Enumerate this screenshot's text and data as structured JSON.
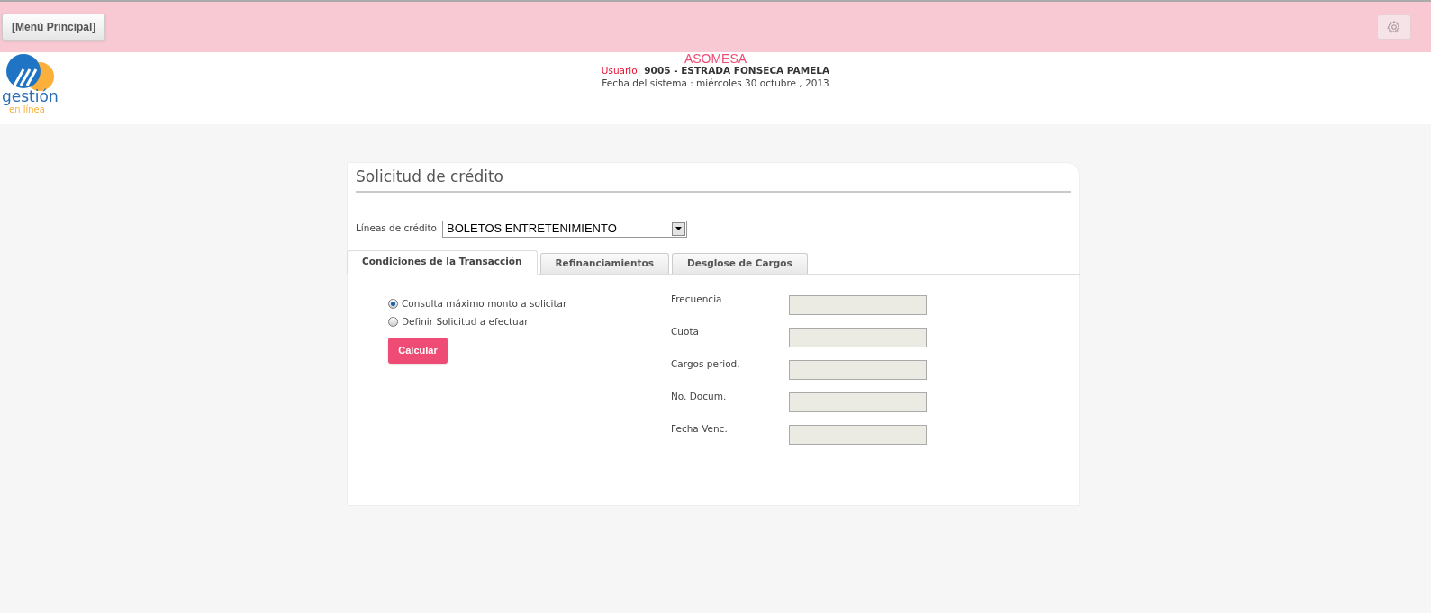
{
  "header": {
    "menu_button": "[Menú Principal]"
  },
  "logo": {
    "title": "gestión",
    "subtitle": "en línea"
  },
  "info": {
    "company": "ASOMESA",
    "user_label": "Usuario:",
    "user": "9005 - ESTRADA FONSECA PAMELA",
    "date": "Fecha del sistema : miércoles 30 octubre , 2013"
  },
  "form": {
    "title": "Solicitud de crédito",
    "credit_line_label": "Líneas de crédito",
    "credit_line_value": "BOLETOS ENTRETENIMIENTO",
    "tabs": [
      {
        "label": "Condiciones de la Transacción",
        "selected": true
      },
      {
        "label": "Refinanciamientos",
        "selected": false
      },
      {
        "label": "Desglose de Cargos",
        "selected": false
      }
    ],
    "options": [
      {
        "label": "Consulta máximo monto a solicitar",
        "selected": true
      },
      {
        "label": "Definir Solicitud a efectuar",
        "selected": false
      }
    ],
    "calculate_button": "Calcular",
    "fields": [
      {
        "label": "Frecuencia"
      },
      {
        "label": "Cuota"
      },
      {
        "label": "Cargos period."
      },
      {
        "label": "No. Docum."
      },
      {
        "label": "Fecha Venc."
      }
    ]
  }
}
